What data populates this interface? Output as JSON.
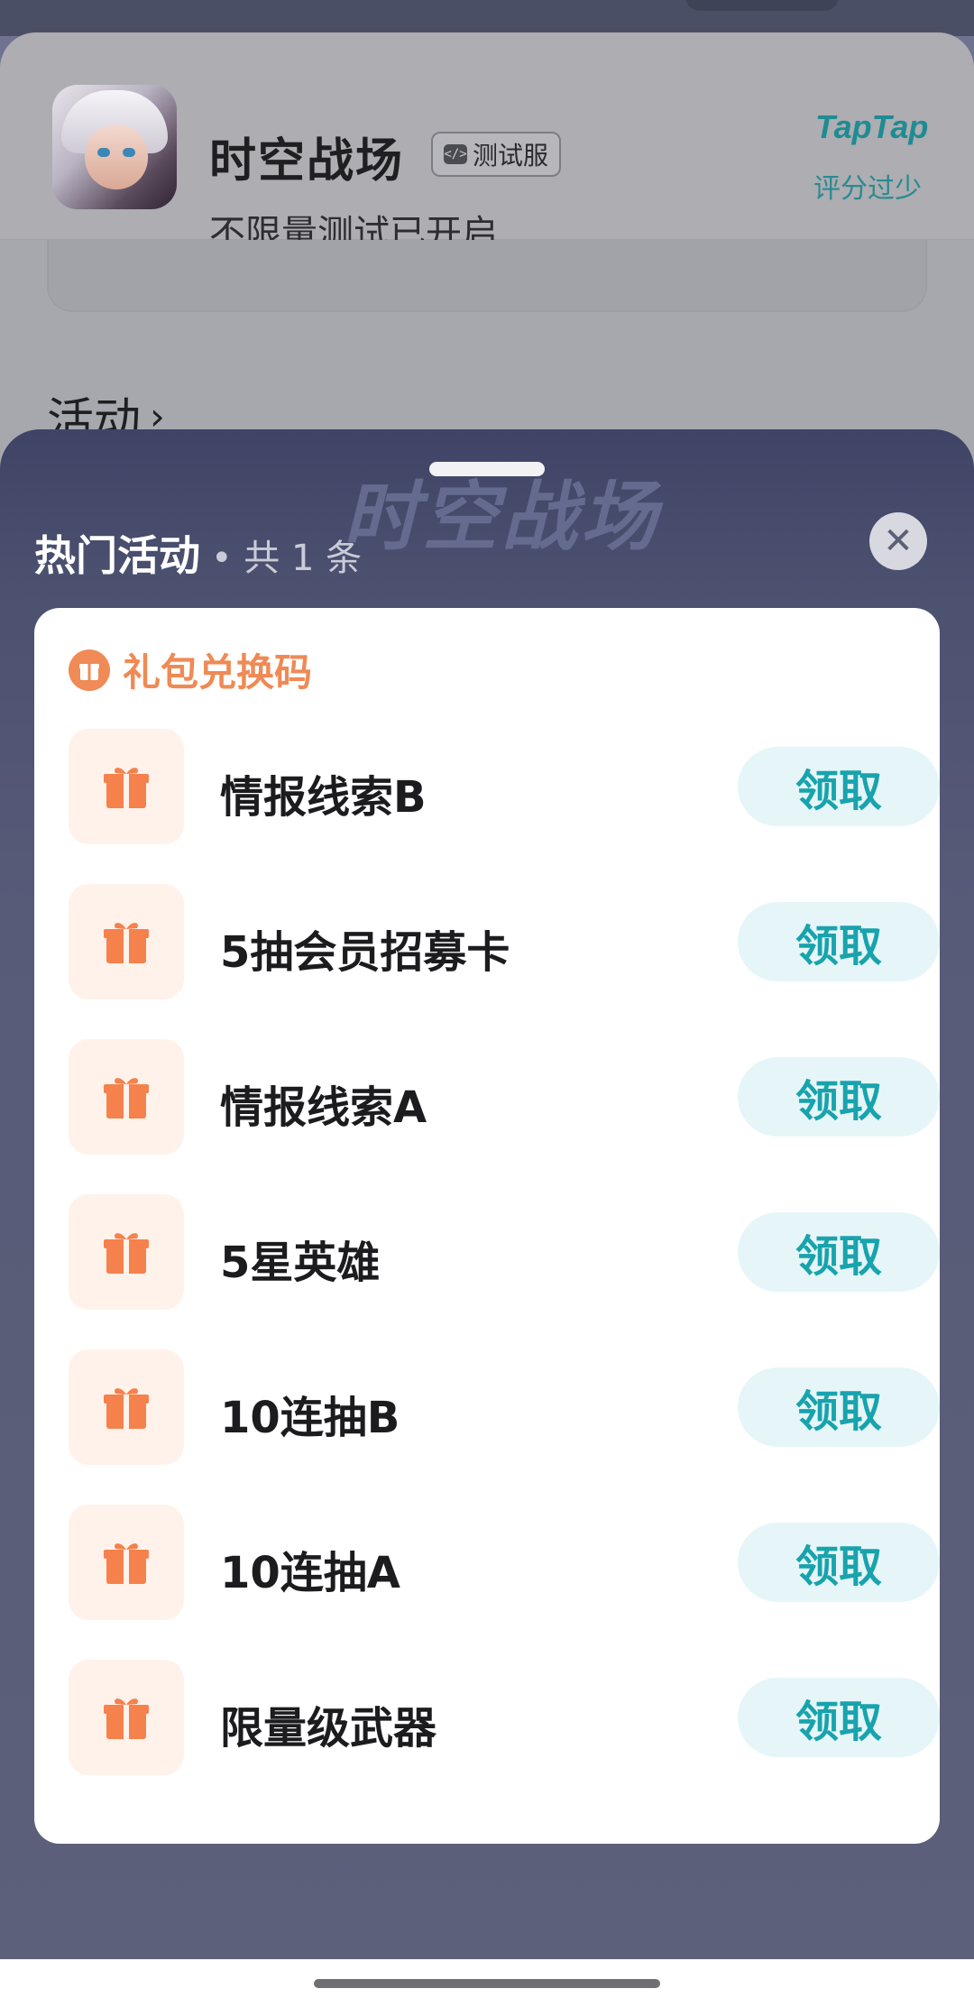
{
  "game": {
    "title": "时空战场",
    "badge": "测试服",
    "subtitle": "不限量测试已开启",
    "platform_logo": "TapTap",
    "rating_note": "评分过少"
  },
  "activity_link": {
    "label": "活动",
    "chevron": "›"
  },
  "sheet": {
    "banner": "时空战场",
    "title": "热门活动",
    "count": "• 共 1 条",
    "close": "✕"
  },
  "panel": {
    "title": "礼包兑换码",
    "icon": "gift-badge-icon",
    "items": [
      {
        "name": "情报线索B",
        "action": "领取"
      },
      {
        "name": "5抽会员招募卡",
        "action": "领取"
      },
      {
        "name": "情报线索A",
        "action": "领取"
      },
      {
        "name": "5星英雄",
        "action": "领取"
      },
      {
        "name": "10连抽B",
        "action": "领取"
      },
      {
        "name": "10连抽A",
        "action": "领取"
      },
      {
        "name": "限量级武器",
        "action": "领取"
      }
    ]
  },
  "colors": {
    "accent_orange": "#ef8a55",
    "accent_teal": "#18a3ad",
    "claim_bg": "#e6f6f8"
  }
}
